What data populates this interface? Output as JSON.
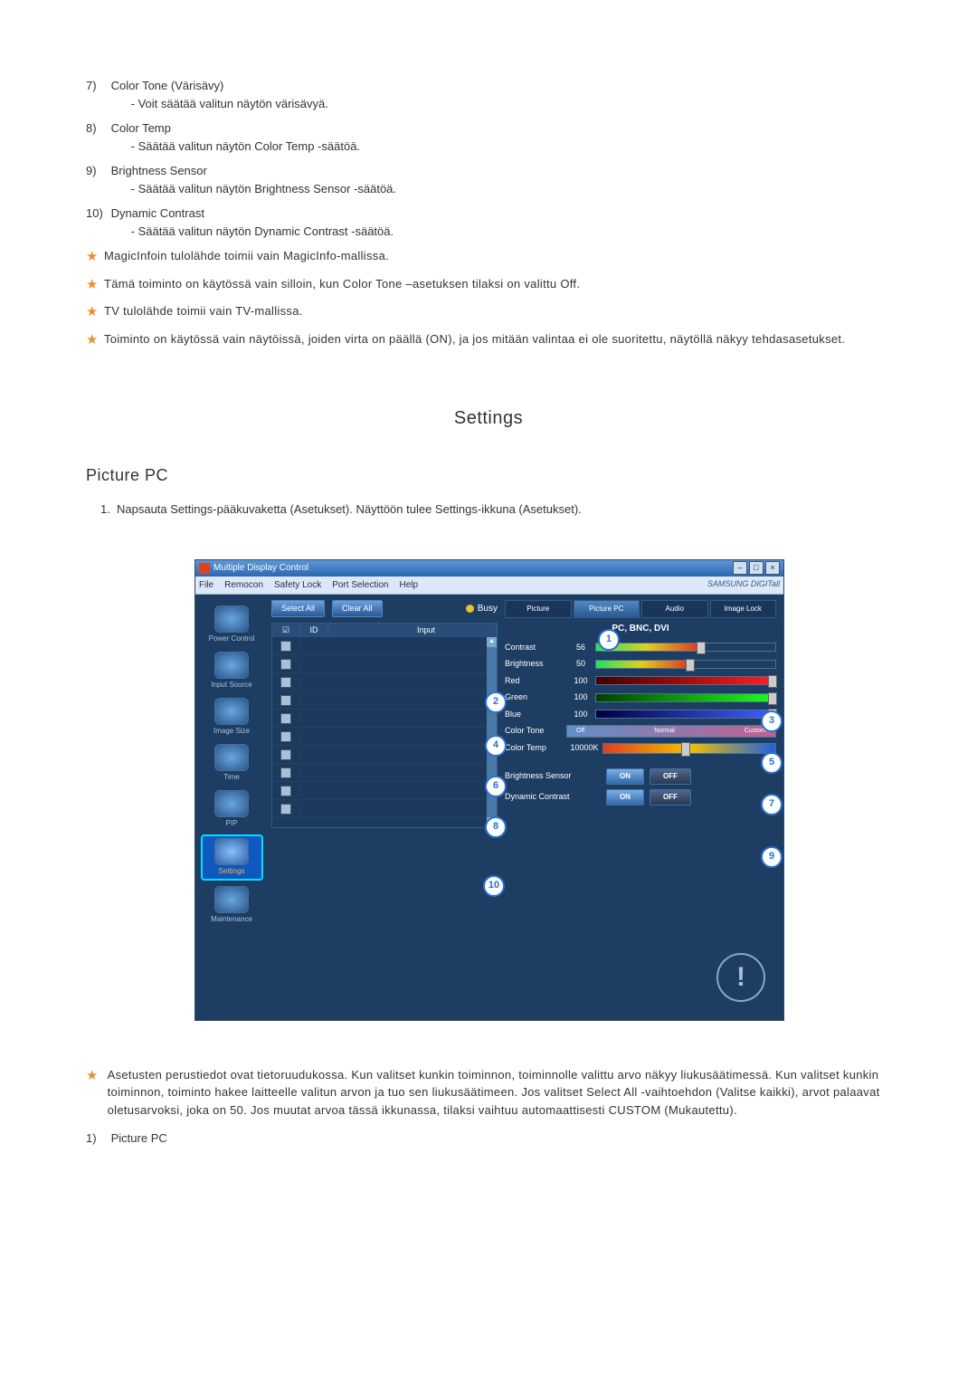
{
  "list": {
    "item7_num": "7)",
    "item7_title": "Color Tone (Värisävy)",
    "item7_sub": "- Voit säätää valitun näytön värisävyä.",
    "item8_num": "8)",
    "item8_title": "Color Temp",
    "item8_sub": "- Säätää valitun näytön Color Temp -säätöä.",
    "item9_num": "9)",
    "item9_title": "Brightness Sensor",
    "item9_sub": "- Säätää valitun näytön Brightness Sensor -säätöä.",
    "item10_num": "10)",
    "item10_title": "Dynamic Contrast",
    "item10_sub": "- Säätää valitun näytön Dynamic Contrast -säätöä."
  },
  "stars": {
    "s1": "MagicInfoin tulolähde toimii vain MagicInfo-mallissa.",
    "s2": "Tämä toiminto on käytössä vain silloin, kun Color Tone –asetuksen tilaksi on valittu Off.",
    "s3": "TV tulolähde toimii vain TV-mallissa.",
    "s4": "Toiminto on käytössä vain näytöissä, joiden virta on päällä (ON), ja jos mitään valintaa ei ole suoritettu, näytöllä näkyy tehdasasetukset."
  },
  "headings": {
    "settings": "Settings",
    "picture_pc": "Picture PC"
  },
  "step1": {
    "num": "1.",
    "text": "Napsauta Settings-pääkuvaketta (Asetukset). Näyttöön tulee Settings-ikkuna (Asetukset)."
  },
  "app": {
    "title": "Multiple Display Control",
    "menu": {
      "file": "File",
      "remocon": "Remocon",
      "safety": "Safety Lock",
      "port": "Port Selection",
      "help": "Help"
    },
    "brand": "SAMSUNG DIGITall",
    "sidebar": {
      "power": "Power Control",
      "input": "Input Source",
      "image": "Image Size",
      "time": "Time",
      "pip": "PIP",
      "settings": "Settings",
      "maintenance": "Maintenance"
    },
    "buttons": {
      "select_all": "Select All",
      "clear_all": "Clear All",
      "busy": "Busy"
    },
    "grid_headers": {
      "chk": "☑",
      "id": "ID",
      "stat": " ",
      "input": "Input"
    },
    "tabs": {
      "picture": "Picture",
      "picture_pc": "Picture PC",
      "audio": "Audio",
      "image_lock": "Image Lock"
    },
    "panel_title": "PC, BNC, DVI",
    "controls": {
      "contrast": "Contrast",
      "contrast_val": "56",
      "brightness": "Brightness",
      "brightness_val": "50",
      "red": "Red",
      "red_val": "100",
      "green": "Green",
      "green_val": "100",
      "blue": "Blue",
      "blue_val": "100",
      "colortone": "Color Tone",
      "ct_off": "Off",
      "ct_normal": "Normal",
      "ct_custom": "Custom",
      "colortemp": "Color Temp",
      "colortemp_val": "10000K",
      "brightness_sensor": "Brightness Sensor",
      "dynamic_contrast": "Dynamic Contrast",
      "on": "ON",
      "off": "OFF"
    }
  },
  "callouts": {
    "c1": "1",
    "c2": "2",
    "c3": "3",
    "c4": "4",
    "c5": "5",
    "c6": "6",
    "c7": "7",
    "c8": "8",
    "c9": "9",
    "c10": "10"
  },
  "bottom_star": "Asetusten perustiedot ovat tietoruudukossa. Kun valitset kunkin toiminnon, toiminnolle valittu arvo näkyy liukusäätimessä. Kun valitset kunkin toiminnon, toiminto hakee laitteelle valitun arvon ja tuo sen liukusäätimeen. Jos valitset Select All -vaihtoehdon (Valitse kaikki), arvot palaavat oletusarvoksi, joka on 50. Jos muutat arvoa tässä ikkunassa, tilaksi vaihtuu automaattisesti CUSTOM (Mukautettu).",
  "list2": {
    "item1_num": "1)",
    "item1_title": "Picture PC"
  }
}
